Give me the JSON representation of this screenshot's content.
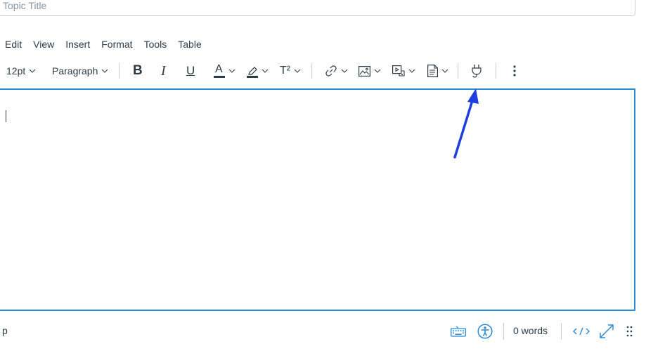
{
  "topic_title": {
    "placeholder": "Topic Title",
    "value": ""
  },
  "menubar": {
    "items": [
      {
        "label": "Edit"
      },
      {
        "label": "View"
      },
      {
        "label": "Insert"
      },
      {
        "label": "Format"
      },
      {
        "label": "Tools"
      },
      {
        "label": "Table"
      }
    ]
  },
  "toolbar": {
    "font_size": "12pt",
    "block_format": "Paragraph",
    "bold_glyph": "B",
    "italic_glyph": "I",
    "underline_glyph": "U",
    "text_color_glyph": "A",
    "superscript_glyph": "T²",
    "icons": [
      "bold-icon",
      "italic-icon",
      "underline-icon",
      "text-color-icon",
      "highlight-icon",
      "superscript-icon",
      "link-icon",
      "image-icon",
      "media-icon",
      "document-icon",
      "plugin-icon",
      "more-icon"
    ],
    "text_color_bar": "#2d3b45",
    "highlight_bar": "#2d3b45"
  },
  "editor": {
    "content": ""
  },
  "statusbar": {
    "path": "p",
    "word_count": "0 words",
    "icons": [
      "keyboard-icon",
      "accessibility-icon",
      "html-code-icon",
      "fullscreen-icon",
      "resize-grip-icon"
    ],
    "accent_color": "#2b8bd6"
  },
  "annotation": {
    "arrow_color": "#1f3ee0"
  }
}
